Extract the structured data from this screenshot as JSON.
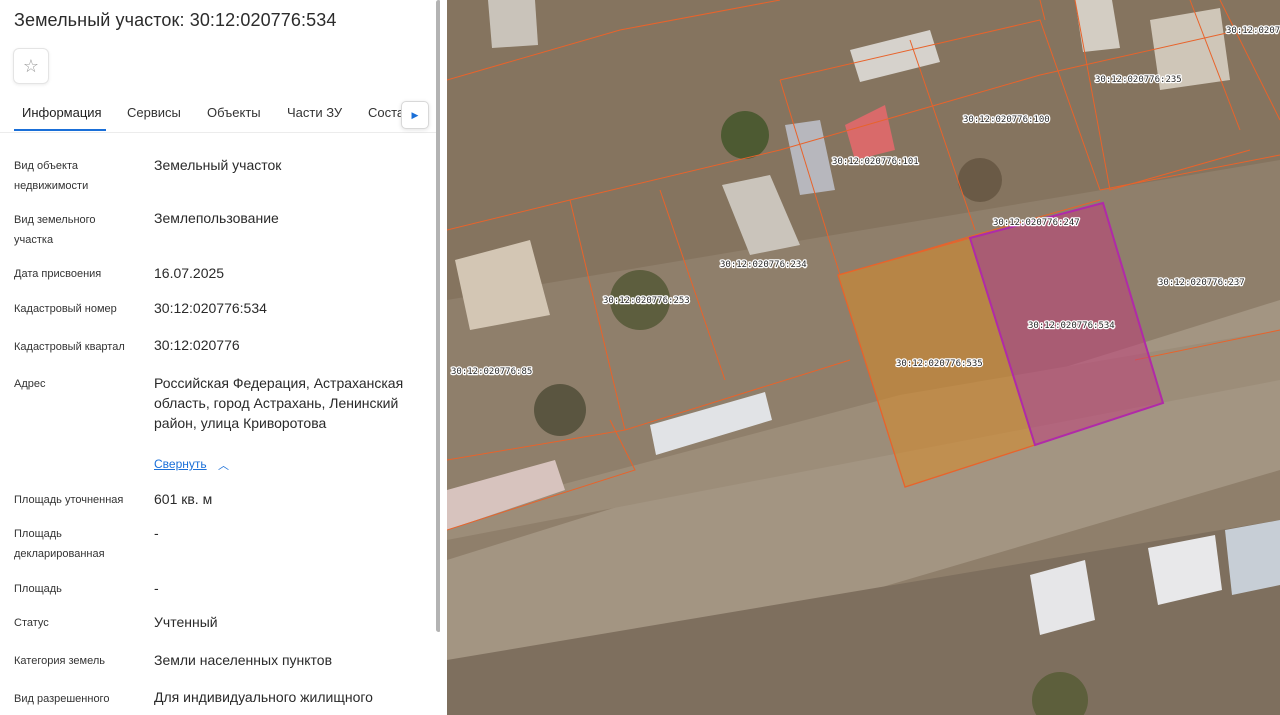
{
  "header": {
    "title": "Земельный участок: 30:12:020776:534"
  },
  "icons": {
    "favorite": "star-outline-icon",
    "tabs_next": "chevron-right-icon",
    "collapse": "chevron-up-icon"
  },
  "tabs": [
    {
      "label": "Информация",
      "active": true
    },
    {
      "label": "Сервисы"
    },
    {
      "label": "Объекты"
    },
    {
      "label": "Части ЗУ"
    },
    {
      "label": "Соста"
    }
  ],
  "info": {
    "object_type": {
      "label": "Вид объекта недвижимости",
      "value": "Земельный участок"
    },
    "land_type": {
      "label": "Вид земельного участка",
      "value": "Землепользование"
    },
    "assign_date": {
      "label": "Дата присвоения",
      "value": "16.07.2025"
    },
    "cad_number": {
      "label": "Кадастровый номер",
      "value": "30:12:020776:534"
    },
    "cad_quarter": {
      "label": "Кадастровый квартал",
      "value": "30:12:020776"
    },
    "address": {
      "label": "Адрес",
      "value": "Российская Федерация, Астраханская область, город Астрахань, Ленинский район, улица Криворотова",
      "collapse": "Свернуть"
    },
    "area_refined": {
      "label": "Площадь уточненная",
      "value": "601 кв. м"
    },
    "area_declared": {
      "label": "Площадь декларированная",
      "value": "-"
    },
    "area": {
      "label": "Площадь",
      "value": "-"
    },
    "status": {
      "label": "Статус",
      "value": "Учтенный"
    },
    "category": {
      "label": "Категория земель",
      "value": "Земли населенных пунктов"
    },
    "permitted_use": {
      "label": "Вид разрешенного",
      "value": "Для индивидуального жилищного"
    }
  },
  "map": {
    "colors": {
      "boundary": "#e8632b",
      "selected": "#b02aa8",
      "selected_fill": "#c0407a",
      "neighbor_fill": "#d98a28"
    },
    "parcel_labels": [
      "30:12:020776:235",
      "30:12:020776:100",
      "30:12:020776:101",
      "30:12:020776:247",
      "30:12:020776:234",
      "30:12:020776:253",
      "30:12:020776:237",
      "30:12:020776:534",
      "30:12:020776:535",
      "30:12:020776:85",
      "30:12:02077"
    ]
  }
}
